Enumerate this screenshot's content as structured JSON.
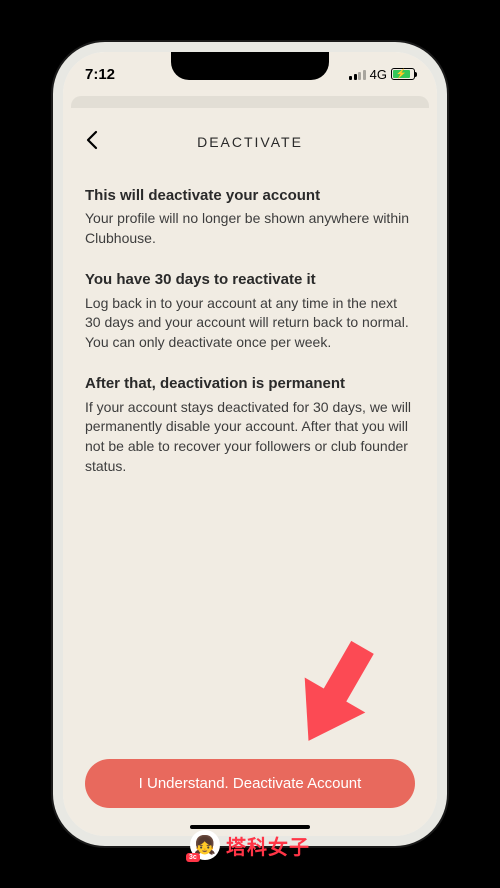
{
  "status": {
    "time": "7:12",
    "network": "4G"
  },
  "header": {
    "title": "DEACTIVATE"
  },
  "sections": [
    {
      "title": "This will deactivate your account",
      "body": "Your profile will no longer be shown anywhere within Clubhouse."
    },
    {
      "title": "You have 30 days to reactivate it",
      "body": "Log back in to your account at any time in the next 30 days and your account will return back to normal. You can only deactivate once per week."
    },
    {
      "title": "After that, deactivation is permanent",
      "body": "If your account stays deactivated for 30 days, we will permanently disable your account. After that you will not be able to recover your followers or club founder status."
    }
  ],
  "button": {
    "label": "I Understand. Deactivate Account"
  },
  "watermark": {
    "badge": "3c",
    "text": "塔科女子"
  }
}
